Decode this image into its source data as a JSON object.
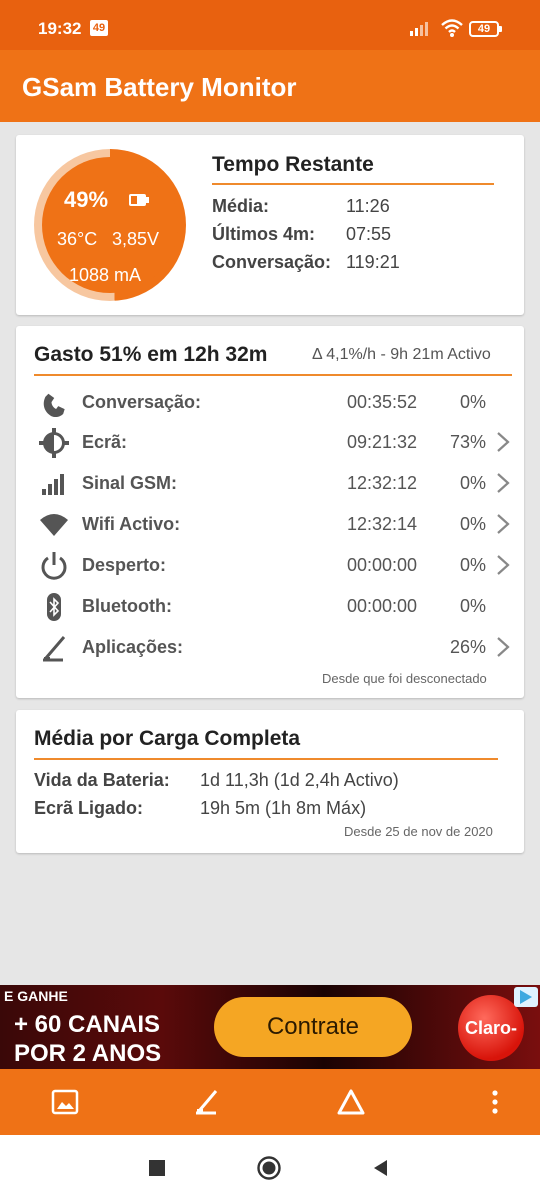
{
  "status": {
    "time": "19:32",
    "notif_badge": "49",
    "battery_level": "49"
  },
  "app": {
    "title": "GSam Battery Monitor"
  },
  "summary": {
    "percent": "49%",
    "temperature": "36°C",
    "voltage": "3,85V",
    "current": "1088 mA",
    "title": "Tempo Restante",
    "rows": [
      {
        "label": "Média:",
        "value": "11:26"
      },
      {
        "label": "Últimos 4m:",
        "value": "07:55"
      },
      {
        "label": "Conversação:",
        "value": "119:21"
      }
    ]
  },
  "usage": {
    "title": "Gasto 51% em 12h 32m",
    "rate": "Δ 4,1%/h - 9h 21m Activo",
    "rows": [
      {
        "icon": "phone-icon",
        "label": "Conversação:",
        "time": "00:35:52",
        "pct": "0%",
        "chevron": false
      },
      {
        "icon": "screen-brightness-icon",
        "label": "Ecrã:",
        "time": "09:21:32",
        "pct": "73%",
        "chevron": true
      },
      {
        "icon": "signal-bars-icon",
        "label": "Sinal GSM:",
        "time": "12:32:12",
        "pct": "0%",
        "chevron": true
      },
      {
        "icon": "wifi-icon",
        "label": "Wifi Activo:",
        "time": "12:32:14",
        "pct": "0%",
        "chevron": true
      },
      {
        "icon": "power-icon",
        "label": "Desperto:",
        "time": "00:00:00",
        "pct": "0%",
        "chevron": true
      },
      {
        "icon": "bluetooth-icon",
        "label": "Bluetooth:",
        "time": "00:00:00",
        "pct": "0%",
        "chevron": false
      },
      {
        "icon": "apps-gauge-icon",
        "label": "Aplicações:",
        "time": "",
        "pct": "26%",
        "chevron": true
      }
    ],
    "footnote": "Desde que foi desconectado"
  },
  "average": {
    "title": "Média por Carga Completa",
    "rows": [
      {
        "label": "Vida da Bateria:",
        "value": "1d 11,3h (1d 2,4h Activo)"
      },
      {
        "label": "Ecrã Ligado:",
        "value": "19h 5m (1h 8m Máx)"
      }
    ],
    "footnote": "Desde 25 de nov de 2020"
  },
  "ad": {
    "line1": "E GANHE",
    "line2": "+ 60 CANAIS",
    "line3": "POR 2 ANOS",
    "button": "Contrate",
    "brand": "Claro-"
  },
  "colors": {
    "accent": "#ef7216",
    "status_bar": "#e8610f"
  }
}
